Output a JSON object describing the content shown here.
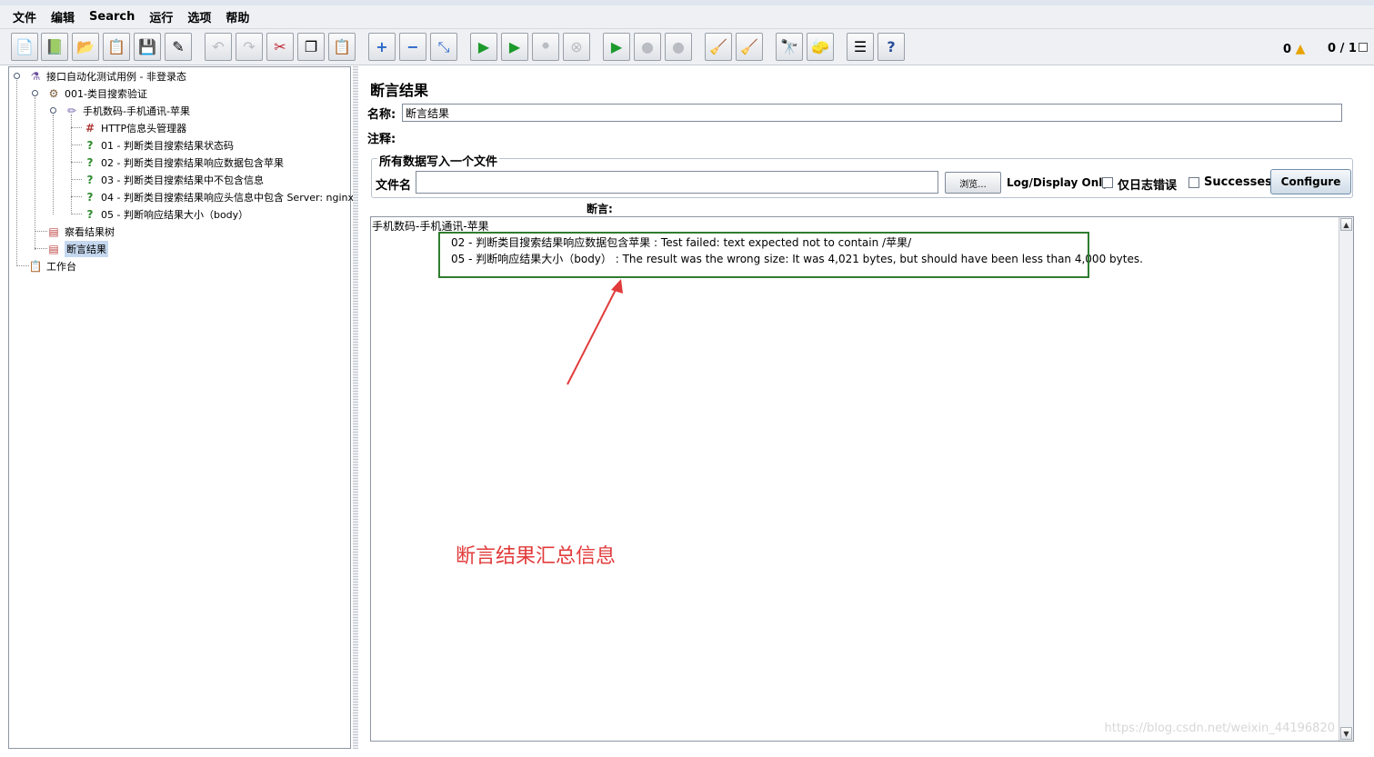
{
  "menu": [
    "文件",
    "编辑",
    "Search",
    "运行",
    "选项",
    "帮助"
  ],
  "toolbar": {
    "status_warnings": "0",
    "status_threads": "0 / 1"
  },
  "tree": {
    "root": "接口自动化测试用例 - 非登录态",
    "thread_group": "001-类目搜索验证",
    "sampler": "手机数码-手机通讯-苹果",
    "header_manager": "HTTP信息头管理器",
    "assertions": [
      "01 - 判断类目搜索结果状态码",
      "02 - 判断类目搜索结果响应数据包含苹果",
      "03 - 判断类目搜索结果中不包含信息",
      "04 - 判断类目搜索结果响应头信息中包含 Server: nginx",
      "05 - 判断响应结果大小（body）"
    ],
    "listener_tree": "察看结果树",
    "listener_assert": "断言结果",
    "workbench": "工作台"
  },
  "panel": {
    "title": "断言结果",
    "name_label": "名称:",
    "name_value": "断言结果",
    "comment_label": "注释:",
    "fieldset_legend": "所有数据写入一个文件",
    "file_label": "文件名",
    "browse": "浏览...",
    "log_display": "Log/Display Only:",
    "errors_only": "仅日志错误",
    "successes": "Successes",
    "configure": "Configure",
    "assertion_label": "断言:"
  },
  "results": {
    "root": "手机数码-手机通讯-苹果",
    "lines": [
      "02 - 判断类目搜索结果响应数据包含苹果 : Test failed: text expected not to contain /苹果/",
      "05 - 判断响应结果大小（body） : The result was the wrong size: It was 4,021 bytes, but should have been less than 4,000 bytes."
    ]
  },
  "annotation": "断言结果汇总信息",
  "watermark": "https://blog.csdn.net/weixin_44196820"
}
